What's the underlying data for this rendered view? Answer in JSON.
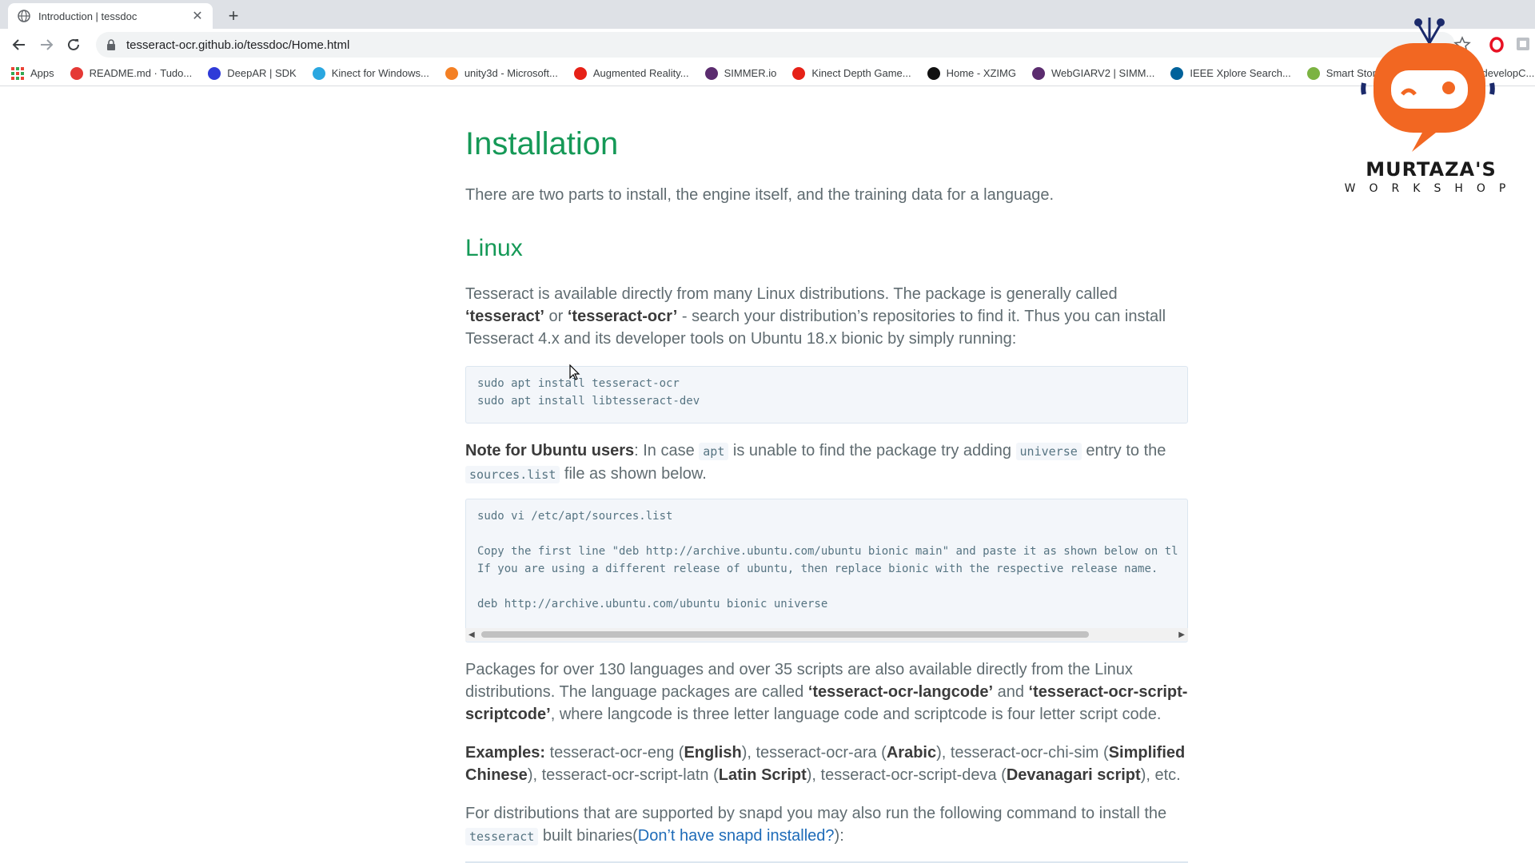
{
  "browser": {
    "tab_title": "Introduction | tessdoc",
    "url": "tesseract-ocr.github.io/tessdoc/Home.html",
    "bookmarks": [
      {
        "label": "Apps",
        "icon": "apps-grid-icon",
        "color": "#1a73e8"
      },
      {
        "label": "README.md · Tudo...",
        "icon": "g-icon",
        "color": "#e53935"
      },
      {
        "label": "DeepAR | SDK",
        "icon": "ar-icon",
        "color": "#2f3bd8"
      },
      {
        "label": "Kinect for Windows...",
        "icon": "v-icon",
        "color": "#2aa7e0"
      },
      {
        "label": "unity3d - Microsoft...",
        "icon": "stack-icon",
        "color": "#f48024"
      },
      {
        "label": "Augmented Reality...",
        "icon": "youtube-icon",
        "color": "#e62117"
      },
      {
        "label": "SIMMER.io",
        "icon": "simmer-icon",
        "color": "#5b2c6f"
      },
      {
        "label": "Kinect Depth Game...",
        "icon": "youtube-icon",
        "color": "#e62117"
      },
      {
        "label": "Home - XZIMG",
        "icon": "xzimg-icon",
        "color": "#111111"
      },
      {
        "label": "WebGIARV2 | SIMM...",
        "icon": "simmer-icon",
        "color": "#5b2c6f"
      },
      {
        "label": "IEEE Xplore Search...",
        "icon": "ieee-icon",
        "color": "#00629b"
      },
      {
        "label": "Smart Stor... Tech...",
        "icon": "smart-icon",
        "color": "#7cb342"
      },
      {
        "label": "Eas... developC...",
        "icon": "e-icon",
        "color": "#1e88e5"
      }
    ]
  },
  "doc": {
    "h1": "Installation",
    "intro": "There are two parts to install, the engine itself, and the training data for a language.",
    "h2_linux": "Linux",
    "linux_p1": "Tesseract is available directly from many Linux distributions. The package is generally called",
    "linux_p1_b1": "‘tesseract’",
    "linux_p1_or": " or ",
    "linux_p1_b2": "‘tesseract-ocr’",
    "linux_p1_rest": " - search your distribution’s repositories to find it. Thus you can install Tesseract 4.x and its developer tools on Ubuntu 18.x bionic by simply running:",
    "code1": "sudo apt install tesseract-ocr\nsudo apt install libtesseract-dev",
    "note_b": "Note for Ubuntu users",
    "note_1": ": In case ",
    "note_apt": "apt",
    "note_2": " is unable to find the package try adding ",
    "note_universe": "universe",
    "note_3": " entry to the ",
    "note_sources": "sources.list",
    "note_4": " file as shown below.",
    "code2": "sudo vi /etc/apt/sources.list\n\nCopy the first line \"deb http://archive.ubuntu.com/ubuntu bionic main\" and paste it as shown below on tl\nIf you are using a different release of ubuntu, then replace bionic with the respective release name.\n\ndeb http://archive.ubuntu.com/ubuntu bionic universe",
    "pkg_1": "Packages for over 130 languages and over 35 scripts are also available directly from the Linux distributions. The language packages are called ",
    "pkg_b1": "‘tesseract-ocr-langcode’",
    "pkg_and": " and ",
    "pkg_b2": "‘tesseract-ocr-script-scriptcode’",
    "pkg_2": ", where langcode is three letter language code and scriptcode is four letter script code.",
    "ex_b": "Examples:",
    "ex_1": " tesseract-ocr-eng (",
    "ex_eng": "English",
    "ex_2": "), tesseract-ocr-ara (",
    "ex_ara": "Arabic",
    "ex_3": "), tesseract-ocr-chi-sim (",
    "ex_chi": "Simplified Chinese",
    "ex_4": "), tesseract-ocr-script-latn (",
    "ex_latn": "Latin Script",
    "ex_5": "), tesseract-ocr-script-deva (",
    "ex_deva": "Devanagari script",
    "ex_6": "), etc.",
    "snap_1": "For distributions that are supported by snapd you may also run the following command to install the ",
    "snap_code": "tesseract",
    "snap_2": " built binaries(",
    "snap_link": "Don’t have snapd installed?",
    "snap_3": "):"
  },
  "watermark": {
    "brand": "MURTAZA'S",
    "sub": "WORKSHOP"
  },
  "colors": {
    "heading": "#159957",
    "text": "#606c71",
    "link": "#1e6bb8",
    "logo_orange": "#f26722",
    "logo_navy": "#1b2a6b"
  }
}
